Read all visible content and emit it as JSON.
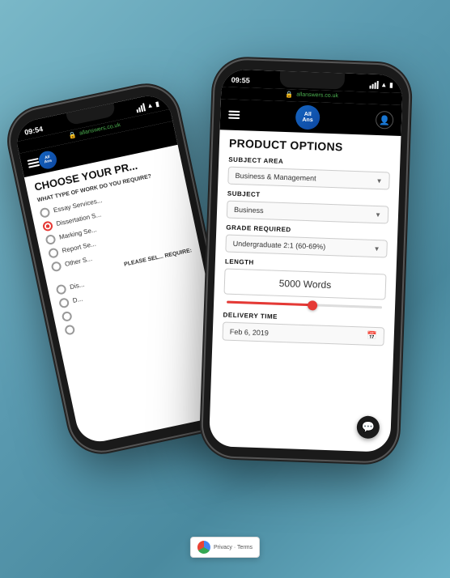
{
  "back_phone": {
    "status_time": "09:54",
    "url": "allanswers.co.uk",
    "title": "CHOOSE YOUR PR...",
    "question": "WHAT TYPE OF WORK DO YOU REQUIRE?",
    "options": [
      {
        "label": "Essay Services...",
        "selected": false
      },
      {
        "label": "Dissertation S...",
        "selected": true
      },
      {
        "label": "Marking Se...",
        "selected": false
      },
      {
        "label": "Report Se...",
        "selected": false
      },
      {
        "label": "Other S...",
        "selected": false
      }
    ],
    "please_select": "PLEASE SEL... REQUIRE:",
    "sub_options": [
      "Dis...",
      "D...",
      "",
      ""
    ]
  },
  "front_phone": {
    "status_time": "09:55",
    "url": "allanswers.co.uk",
    "nav": {
      "menu_label": "menu",
      "logo_text": "All Answers",
      "user_label": "user"
    },
    "title": "PRODUCT OPTIONS",
    "fields": {
      "subject_area_label": "SUBJECT AREA",
      "subject_area_value": "Business & Management",
      "subject_label": "SUBJECT",
      "subject_value": "Business",
      "grade_label": "GRADE REQUIRED",
      "grade_value": "Undergraduate 2:1 (60-69%)",
      "length_label": "LENGTH",
      "length_value": "5000 Words",
      "slider_percent": 55,
      "delivery_label": "DELIVERY TIME",
      "delivery_value": "Feb 6, 2019"
    },
    "chat_icon": "💬",
    "captcha_text": "Privacy · Terms"
  },
  "colors": {
    "accent_red": "#e53935",
    "brand_blue": "#1565c0",
    "nav_dark": "#000000"
  }
}
